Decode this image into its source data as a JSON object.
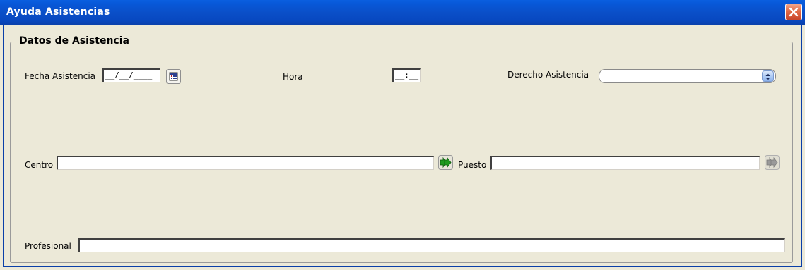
{
  "window": {
    "title": "Ayuda Asistencias"
  },
  "group": {
    "title": "Datos de Asistencia"
  },
  "fields": {
    "fecha_label": "Fecha Asistencia",
    "fecha_value": "__/__/____",
    "hora_label": "Hora",
    "hora_value": "__:__",
    "derecho_label": "Derecho  Asistencia",
    "derecho_value": "",
    "centro_label": "Centro",
    "centro_value": "",
    "puesto_label": "Puesto",
    "puesto_value": "",
    "profesional_label": "Profesional",
    "profesional_value": ""
  },
  "icons": {
    "close": "close-icon",
    "calendar": "calendar-icon",
    "centro_lookup": "double-arrow-right-icon",
    "puesto_lookup": "double-arrow-right-icon",
    "combo_arrow": "up-down-arrow-icon"
  },
  "colors": {
    "titlebar": "#0a4fc8",
    "window_bg": "#ece9d8",
    "lookup_active": "#1e9a1e",
    "lookup_disabled": "#9a9a9a"
  }
}
